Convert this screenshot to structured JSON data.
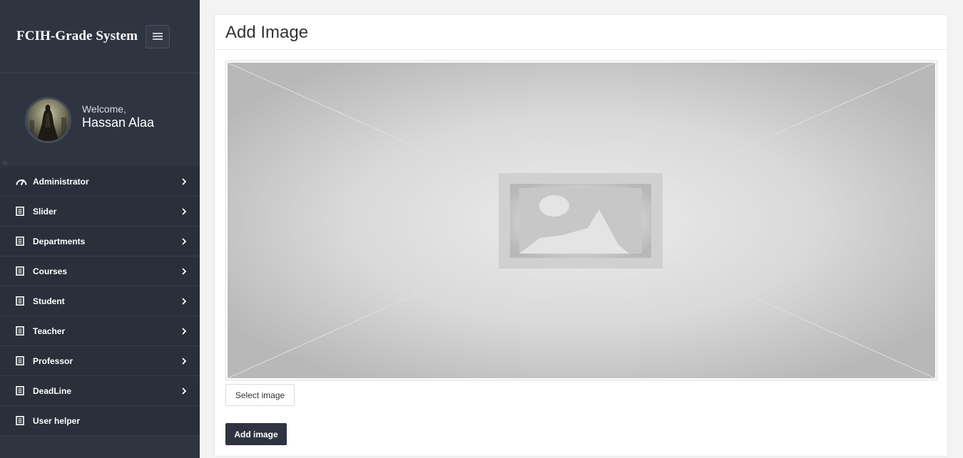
{
  "app": {
    "title": "FCIH-Grade System"
  },
  "profile": {
    "welcome_label": "Welcome,",
    "user_name": "Hassan Alaa"
  },
  "sidebar": {
    "items": [
      {
        "label": "Administrator",
        "icon": "dashboard-gauge-icon",
        "has_submenu": true
      },
      {
        "label": "Slider",
        "icon": "document-icon",
        "has_submenu": true
      },
      {
        "label": "Departments",
        "icon": "document-icon",
        "has_submenu": true
      },
      {
        "label": "Courses",
        "icon": "document-icon",
        "has_submenu": true
      },
      {
        "label": "Student",
        "icon": "document-icon",
        "has_submenu": true
      },
      {
        "label": "Teacher",
        "icon": "document-icon",
        "has_submenu": true
      },
      {
        "label": "Professor",
        "icon": "document-icon",
        "has_submenu": true
      },
      {
        "label": "DeadLine",
        "icon": "document-icon",
        "has_submenu": true
      },
      {
        "label": "User helper",
        "icon": "document-icon",
        "has_submenu": false
      }
    ]
  },
  "main": {
    "panel_title": "Add Image",
    "image_placeholder_icon": "image-placeholder-icon",
    "select_button_label": "Select image",
    "submit_button_label": "Add image"
  },
  "colors": {
    "sidebar_bg": "#2f3441",
    "menu_bg": "#2b2f3a",
    "primary_button": "#2f3441",
    "page_bg": "#f3f3f4"
  }
}
